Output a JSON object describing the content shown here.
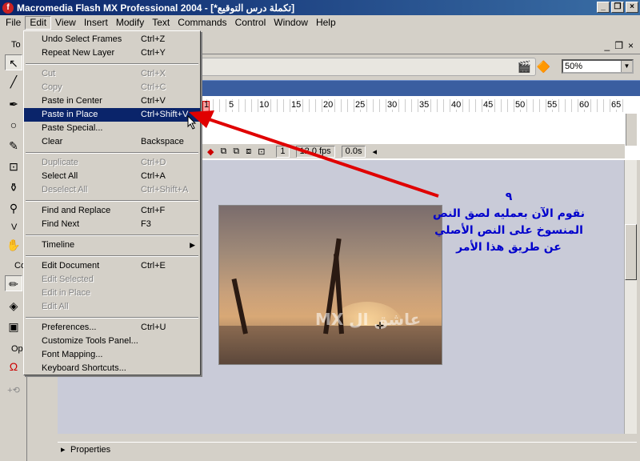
{
  "window": {
    "title": "Macromedia Flash MX Professional 2004 - [*تكملة درس التوقيع]",
    "icon": "flash-app-icon"
  },
  "menubar": [
    "File",
    "Edit",
    "View",
    "Insert",
    "Modify",
    "Text",
    "Commands",
    "Control",
    "Window",
    "Help"
  ],
  "tools_panel": {
    "labels": [
      "To",
      "V",
      "Co",
      "Op"
    ]
  },
  "edit_menu": {
    "items": [
      {
        "label": "Undo Select Frames",
        "shortcut": "Ctrl+Z",
        "enabled": true
      },
      {
        "label": "Repeat New Layer",
        "shortcut": "Ctrl+Y",
        "enabled": true
      },
      {
        "label": "Cut",
        "shortcut": "Ctrl+X",
        "enabled": false
      },
      {
        "label": "Copy",
        "shortcut": "Ctrl+C",
        "enabled": false
      },
      {
        "label": "Paste in Center",
        "shortcut": "Ctrl+V",
        "enabled": true
      },
      {
        "label": "Paste in Place",
        "shortcut": "Ctrl+Shift+V",
        "enabled": true,
        "highlighted": true
      },
      {
        "label": "Paste Special...",
        "shortcut": "",
        "enabled": true
      },
      {
        "label": "Clear",
        "shortcut": "Backspace",
        "enabled": true
      },
      {
        "label": "Duplicate",
        "shortcut": "Ctrl+D",
        "enabled": false
      },
      {
        "label": "Select All",
        "shortcut": "Ctrl+A",
        "enabled": true
      },
      {
        "label": "Deselect All",
        "shortcut": "Ctrl+Shift+A",
        "enabled": false
      },
      {
        "label": "Find and Replace",
        "shortcut": "Ctrl+F",
        "enabled": true
      },
      {
        "label": "Find Next",
        "shortcut": "F3",
        "enabled": true
      },
      {
        "label": "Timeline",
        "shortcut": "",
        "enabled": true,
        "submenu": true
      },
      {
        "label": "Edit Document",
        "shortcut": "Ctrl+E",
        "enabled": true
      },
      {
        "label": "Edit Selected",
        "shortcut": "",
        "enabled": false
      },
      {
        "label": "Edit in Place",
        "shortcut": "",
        "enabled": false
      },
      {
        "label": "Edit All",
        "shortcut": "",
        "enabled": false
      },
      {
        "label": "Preferences...",
        "shortcut": "Ctrl+U",
        "enabled": true
      },
      {
        "label": "Customize Tools Panel...",
        "shortcut": "",
        "enabled": true
      },
      {
        "label": "Font Mapping...",
        "shortcut": "",
        "enabled": true
      },
      {
        "label": "Keyboard Shortcuts...",
        "shortcut": "",
        "enabled": true
      }
    ]
  },
  "zoom": {
    "value": "50%"
  },
  "timeline": {
    "frame_numbers": [
      "1",
      "5",
      "10",
      "15",
      "20",
      "25",
      "30",
      "35",
      "40",
      "45",
      "50",
      "55",
      "60",
      "65"
    ],
    "current_frame": "1",
    "fps": "12.0 fps",
    "time": "0.0s"
  },
  "stage": {
    "watermark": "MX عاشق ال"
  },
  "annotation": {
    "number": "٩",
    "lines": [
      "نقوم الآن بعمليه لصق النص",
      "المنسوخ على النص الأصلي",
      "عن طريق هذا الأمر"
    ],
    "color": "#0000cc",
    "arrow_color": "#e00000"
  },
  "properties_panel": {
    "label": "Properties"
  }
}
